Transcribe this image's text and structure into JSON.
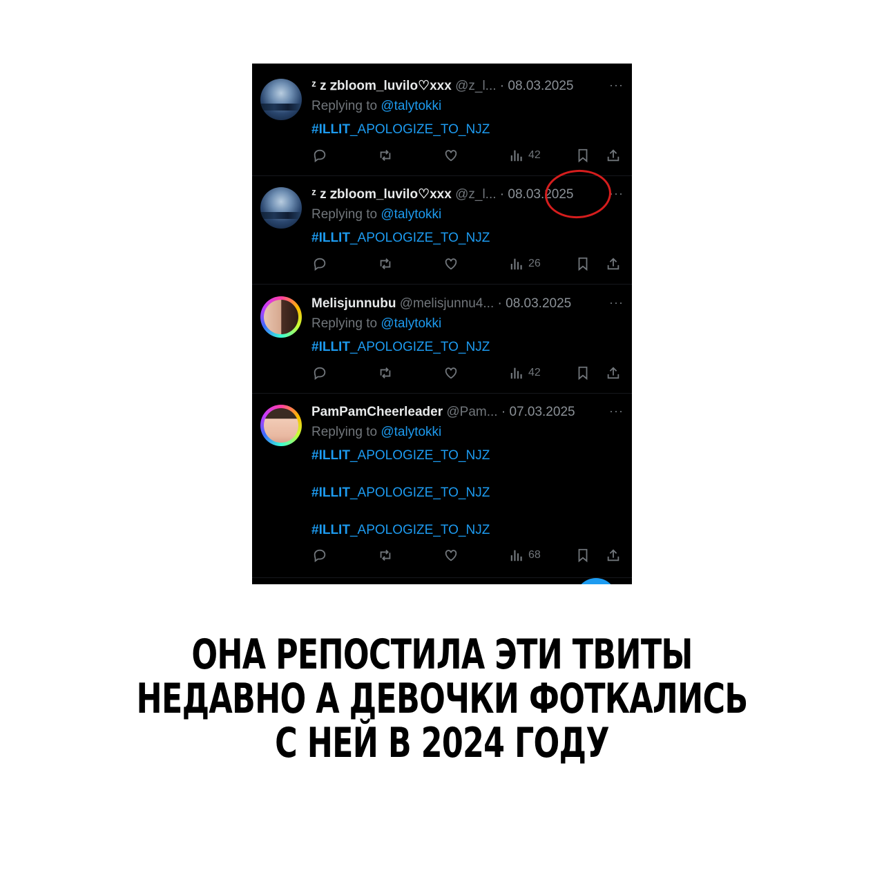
{
  "tweets": [
    {
      "display_name": "ᶻ z 𝗓bloom_luvilo♡xxx",
      "handle": "@z_l...",
      "date": "· 08.03.2025",
      "more": "···",
      "reply_prefix": "Replying to ",
      "reply_handle": "@talytokki",
      "hashtag_prefix": "#ILLIT",
      "hashtag_rest": "_APOLOGIZE_TO_NJZ",
      "views": "42",
      "avatar": "landscape-avatar"
    },
    {
      "display_name": "ᶻ z 𝗓bloom_luvilo♡xxx",
      "handle": "@z_l...",
      "date": "· 08.03.2025",
      "more": "···",
      "reply_prefix": "Replying to ",
      "reply_handle": "@talytokki",
      "hashtag_prefix": "#ILLIT",
      "hashtag_rest": "_APOLOGIZE_TO_NJZ",
      "views": "26",
      "avatar": "landscape-avatar"
    },
    {
      "display_name": "Melisjunnubu",
      "handle": "@melisjunnu4...",
      "date": "· 08.03.2025",
      "more": "···",
      "reply_prefix": "Replying to ",
      "reply_handle": "@talytokki",
      "hashtag_prefix": "#ILLIT",
      "hashtag_rest": "_APOLOGIZE_TO_NJZ",
      "views": "42",
      "avatar": "portrait-avatar"
    },
    {
      "display_name": "PamPamCheerleader",
      "handle": "@Pam...",
      "date": "· 07.03.2025",
      "more": "···",
      "reply_prefix": "Replying to ",
      "reply_handle": "@talytokki",
      "hashtag_prefix": "#ILLIT",
      "hashtag_rest": "_APOLOGIZE_TO_NJZ",
      "views": "68",
      "avatar": "portrait-avatar"
    }
  ],
  "icons": [
    "reply-icon",
    "retweet-icon",
    "like-icon",
    "views-icon",
    "bookmark-icon",
    "share-icon"
  ],
  "colors": {
    "link": "#1d9bf0",
    "muted": "#71767b",
    "annotation": "#d51d1d"
  },
  "caption": {
    "line1": "ОНА РЕПОСТИЛА ЭТИ ТВИТЫ",
    "line2": "НЕДАВНО А ДЕВОЧКИ ФОТКАЛИСЬ",
    "line3": "С НЕЙ В 2024 ГОДУ"
  }
}
